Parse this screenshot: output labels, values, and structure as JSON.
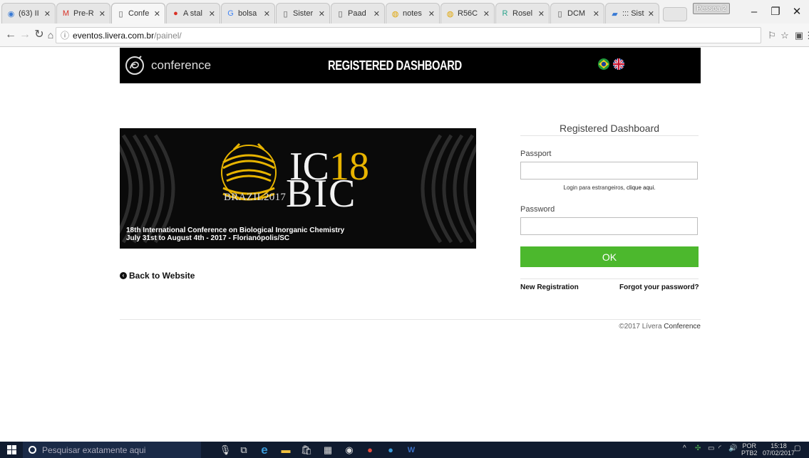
{
  "browser": {
    "tabs": [
      {
        "label": "(63) II",
        "icon": "globe-icon"
      },
      {
        "label": "Pre-R",
        "icon": "gmail-icon"
      },
      {
        "label": "Confe",
        "icon": "page-icon",
        "active": true
      },
      {
        "label": "A stal",
        "icon": "warning-icon"
      },
      {
        "label": "bolsa",
        "icon": "google-icon"
      },
      {
        "label": "Sister",
        "icon": "page-icon"
      },
      {
        "label": "Paad",
        "icon": "page-icon"
      },
      {
        "label": "notes",
        "icon": "coin-icon"
      },
      {
        "label": "R56C",
        "icon": "coin-icon"
      },
      {
        "label": "Rosel",
        "icon": "researchgate-icon"
      },
      {
        "label": "DCM",
        "icon": "page-icon"
      },
      {
        "label": "::: Sist",
        "icon": "image-icon"
      }
    ],
    "profile_label": "Pessoa 2",
    "url_host": "eventos.livera.com.br",
    "url_path": "/painel/"
  },
  "header": {
    "logo_text": "conference",
    "title": "REGISTERED DASHBOARD",
    "languages": [
      "Brazil flag",
      "UK flag"
    ]
  },
  "banner": {
    "ic_prefix": "IC",
    "ic_number": "18",
    "bic_text": "BIC",
    "brazil_text": "BRAZIL2017",
    "conference_name": "18th International Conference on Biological Inorganic Chemistry",
    "dates_location": "July 31st to August 4th - 2017 - Florianópolis/SC"
  },
  "back_link": "Back to Website",
  "login": {
    "title": "Registered Dashboard",
    "passport_label": "Passport",
    "passport_value": "",
    "foreign_hint": "Login para estrangeiros,",
    "foreign_link": "clique aqui.",
    "password_label": "Password",
    "password_value": "",
    "ok_label": "OK",
    "new_registration": "New Registration",
    "forgot_password": "Forgot your password?"
  },
  "footer": {
    "copyright_prefix": "©2017 Lívera",
    "copyright_brand": "Conference"
  },
  "taskbar": {
    "search_placeholder": "Pesquisar exatamente aqui",
    "lang_top": "POR",
    "lang_bottom": "PTB2",
    "time": "15:18",
    "date": "07/02/2017"
  },
  "colors": {
    "ok_button": "#4cb82d",
    "header_bg": "#000000",
    "banner_accent": "#e8b400",
    "taskbar_bg": "#101b2f"
  }
}
